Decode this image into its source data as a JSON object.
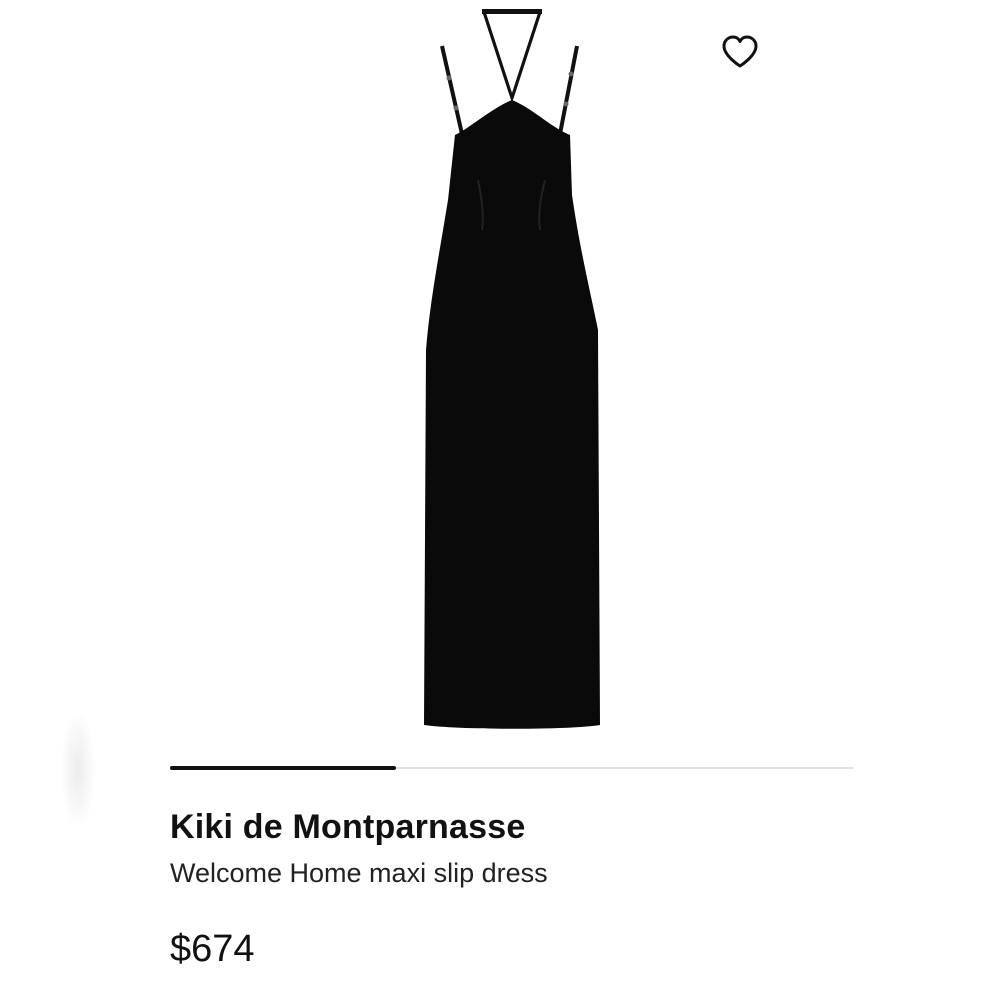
{
  "product": {
    "brand": "Kiki de Montparnasse",
    "name": "Welcome Home maxi slip dress",
    "price": "$674"
  },
  "gallery": {
    "progress_fraction": 0.33,
    "wishlist_icon": "heart-outline-icon"
  },
  "colors": {
    "dress": "#0a0a0a",
    "progress_fill": "#111111",
    "progress_track": "#e3e3e3"
  }
}
